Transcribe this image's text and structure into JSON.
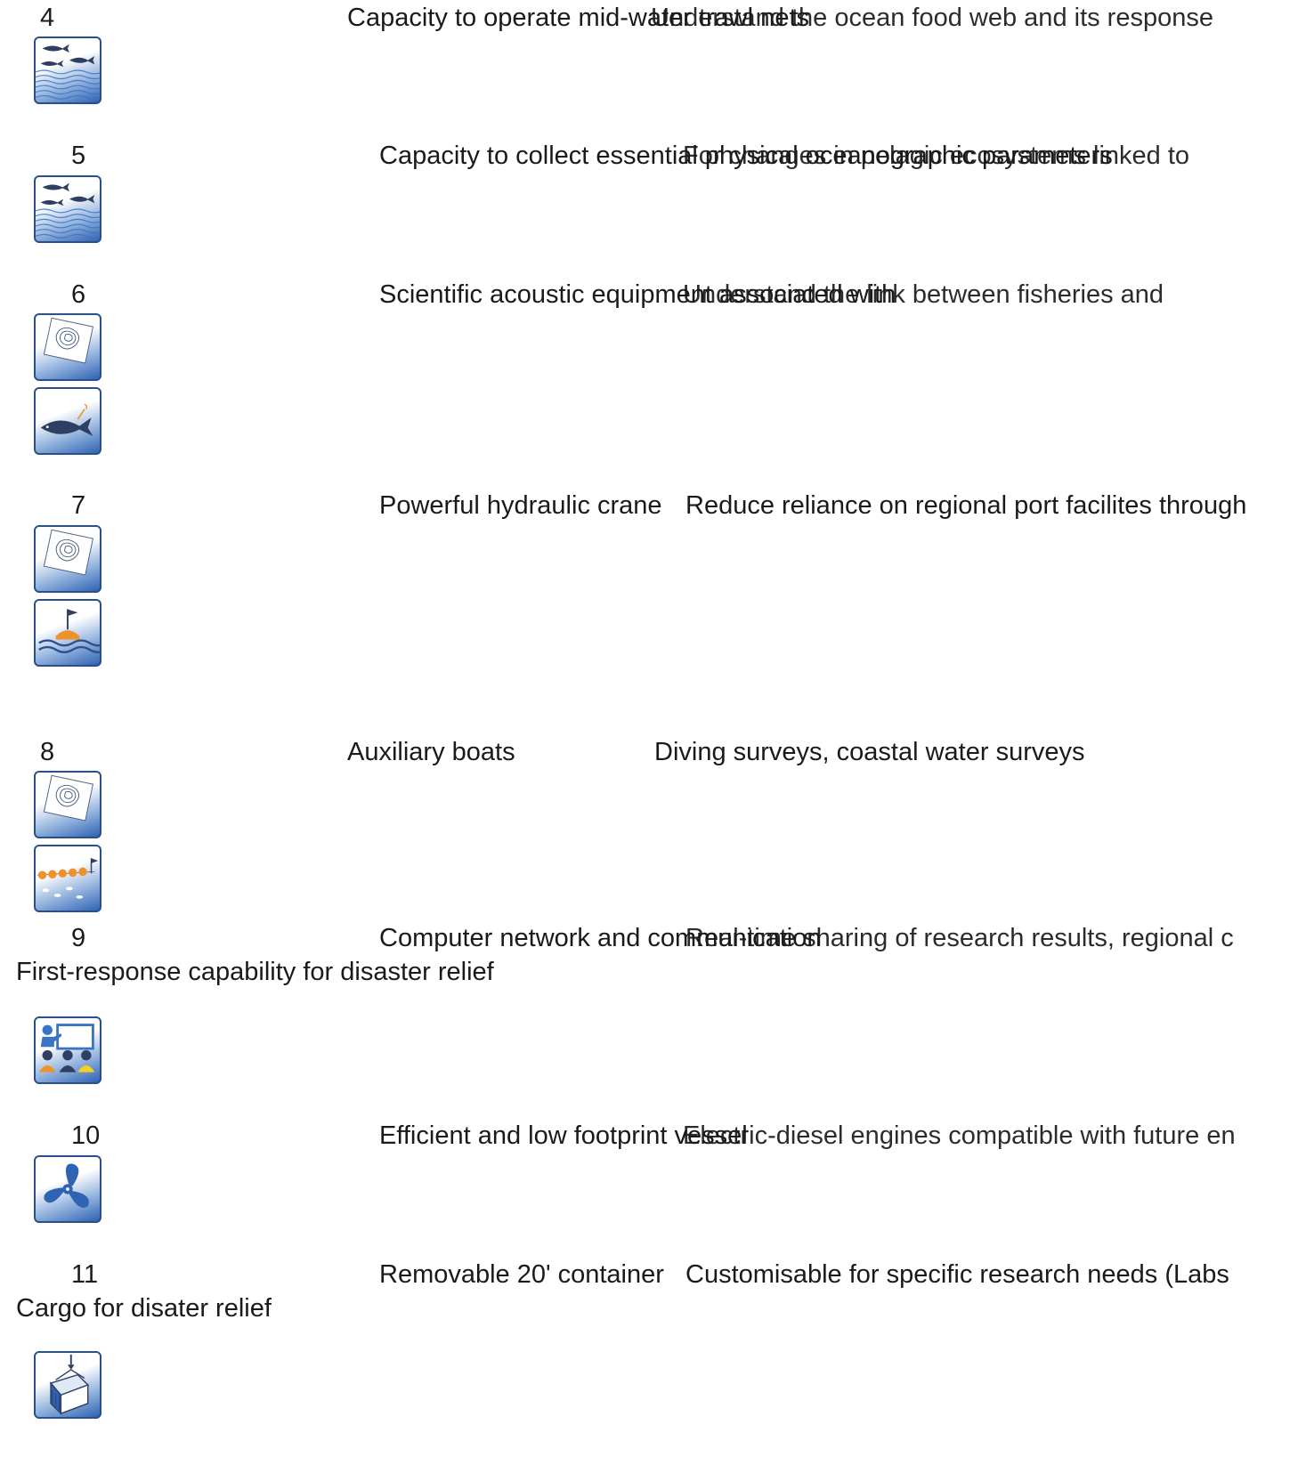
{
  "rows": [
    {
      "number": "4",
      "capability": "Capacity to operate mid-water trawl nets",
      "use": "Understand the ocean food web and its response",
      "icons": [
        "fish-school-icon"
      ]
    },
    {
      "number": "5",
      "capability": "Capacity to collect essential physical oceanographic parameters",
      "use": "For changes in pelagic ecosystems linked to",
      "icons": [
        "fish-school-icon"
      ]
    },
    {
      "number": "6",
      "capability": "Scientific acoustic equipment associated with",
      "use": "Understand the link between fisheries and",
      "icons": [
        "map-contour-icon",
        "tuna-tag-icon"
      ]
    },
    {
      "number": "7",
      "capability": "Powerful hydraulic crane",
      "use": "Reduce reliance on regional port facilites through",
      "icons": [
        "map-contour-icon",
        "buoy-icon"
      ]
    },
    {
      "number": "8",
      "capability": "Auxiliary boats",
      "use": "Diving surveys, coastal water surveys",
      "icons": [
        "map-contour-icon",
        "longline-icon"
      ]
    },
    {
      "number": "9",
      "capability": "Computer network and communication",
      "use": "Real-time sharing of research results, regional c",
      "extra": "First-response capability for disaster relief",
      "icons": [
        "classroom-icon"
      ]
    },
    {
      "number": "10",
      "capability": "Efficient and low footprint vessel",
      "use": "Electric-diesel engines compatible with future en",
      "icons": [
        "propeller-icon"
      ]
    },
    {
      "number": "11",
      "capability": "Removable 20' container",
      "use": "Customisable for specific research needs (Labs",
      "extra": "Cargo for disater relief",
      "icons": [
        "container-crane-icon"
      ]
    }
  ],
  "colors": {
    "navy": "#2a4f8a",
    "fish": "#2e3f63",
    "orange": "#f0922b",
    "gradient_blue": "#2f63b3"
  }
}
